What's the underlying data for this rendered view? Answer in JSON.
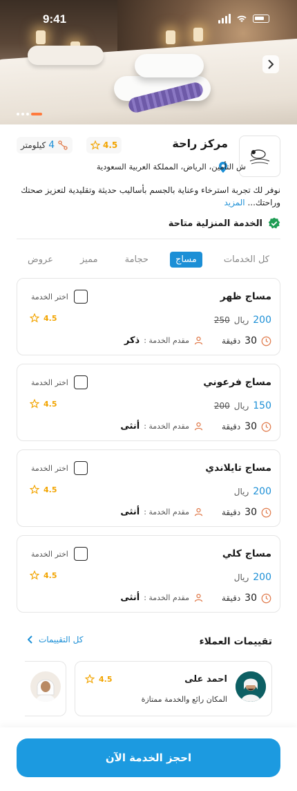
{
  "status_bar": {
    "time": "9:41"
  },
  "center": {
    "name": "مركز راحة",
    "rating": "4.5",
    "distance_value": "4",
    "distance_unit": "كيلومتر",
    "address": "ش التأمين، الرياض، المملكة العربية السعودية",
    "description": "نوفر لك تجربة استرخاء وعناية بالجسم بأساليب حديثة وتقليدية لتعزيز صحتك وراحتك...",
    "more_label": "المزيد",
    "home_service": "الخدمة المنزلية متاحة"
  },
  "tabs": [
    {
      "label": "كل الخدمات",
      "active": false
    },
    {
      "label": "مساج",
      "active": true
    },
    {
      "label": "حجامة",
      "active": false
    },
    {
      "label": "مميز",
      "active": false
    },
    {
      "label": "عروض",
      "active": false
    }
  ],
  "service_labels": {
    "select": "اختر الخدمة",
    "currency": "ريال",
    "duration_unit": "دقيقة",
    "provider": "مقدم الخدمة :"
  },
  "services": [
    {
      "title": "مساج ظهر",
      "price": "200",
      "old_price": "250",
      "rating": "4.5",
      "duration": "30",
      "provider": "ذكر"
    },
    {
      "title": "مساج فرعوني",
      "price": "150",
      "old_price": "200",
      "rating": "4.5",
      "duration": "30",
      "provider": "أنثى"
    },
    {
      "title": "مساج تايلاندي",
      "price": "200",
      "old_price": "",
      "rating": "4.5",
      "duration": "30",
      "provider": "أنثى"
    },
    {
      "title": "مساج كلي",
      "price": "200",
      "old_price": "",
      "rating": "4.5",
      "duration": "30",
      "provider": "أنثى"
    }
  ],
  "reviews": {
    "title": "تقييمات العملاء",
    "all_label": "كل التقييمات",
    "items": [
      {
        "name": "احمد على",
        "rating": "4.5",
        "text": "المكان رائع والخدمة ممتازة"
      }
    ]
  },
  "cta": {
    "label": "احجز الخدمة الآن"
  },
  "colors": {
    "accent": "#1c8fd6",
    "star": "#f2a400",
    "cta": "#1c9ae0",
    "check": "#1f9d55",
    "clock": "#e07a4a"
  },
  "icons": [
    "star-icon",
    "distance-icon",
    "location-pin-icon",
    "check-badge-icon",
    "clock-icon",
    "user-icon",
    "chevron-left-icon",
    "chevron-right-icon"
  ]
}
